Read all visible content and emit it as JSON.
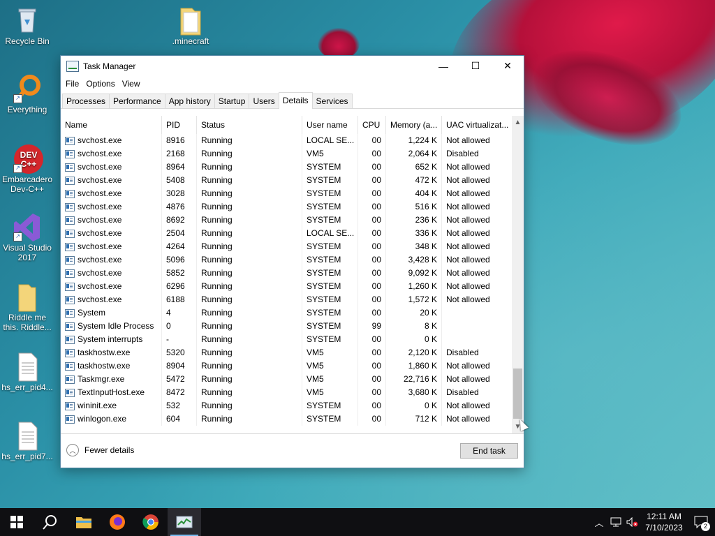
{
  "desktop": {
    "icons": [
      {
        "label": "Recycle Bin"
      },
      {
        "label": ".minecraft"
      },
      {
        "label": "Everything"
      },
      {
        "label": "Embarcadero Dev-C++"
      },
      {
        "label": "Visual Studio 2017"
      },
      {
        "label": "Riddle me this. Riddle..."
      },
      {
        "label": "hs_err_pid4..."
      },
      {
        "label": "hs_err_pid7..."
      }
    ]
  },
  "window": {
    "title": "Task Manager",
    "controls": {
      "minimize": "—",
      "maximize": "☐",
      "close": "✕"
    },
    "menu": [
      "File",
      "Options",
      "View"
    ],
    "tabs": [
      "Processes",
      "Performance",
      "App history",
      "Startup",
      "Users",
      "Details",
      "Services"
    ],
    "active_tab": "Details",
    "columns": [
      "Name",
      "PID",
      "Status",
      "User name",
      "CPU",
      "Memory (a...",
      "UAC virtualizat..."
    ],
    "rows": [
      {
        "name": "svchost.exe",
        "pid": "8916",
        "status": "Running",
        "user": "LOCAL SE...",
        "cpu": "00",
        "mem": "1,224 K",
        "uac": "Not allowed"
      },
      {
        "name": "svchost.exe",
        "pid": "2168",
        "status": "Running",
        "user": "VM5",
        "cpu": "00",
        "mem": "2,064 K",
        "uac": "Disabled"
      },
      {
        "name": "svchost.exe",
        "pid": "8964",
        "status": "Running",
        "user": "SYSTEM",
        "cpu": "00",
        "mem": "652 K",
        "uac": "Not allowed"
      },
      {
        "name": "svchost.exe",
        "pid": "5408",
        "status": "Running",
        "user": "SYSTEM",
        "cpu": "00",
        "mem": "472 K",
        "uac": "Not allowed"
      },
      {
        "name": "svchost.exe",
        "pid": "3028",
        "status": "Running",
        "user": "SYSTEM",
        "cpu": "00",
        "mem": "404 K",
        "uac": "Not allowed"
      },
      {
        "name": "svchost.exe",
        "pid": "4876",
        "status": "Running",
        "user": "SYSTEM",
        "cpu": "00",
        "mem": "516 K",
        "uac": "Not allowed"
      },
      {
        "name": "svchost.exe",
        "pid": "8692",
        "status": "Running",
        "user": "SYSTEM",
        "cpu": "00",
        "mem": "236 K",
        "uac": "Not allowed"
      },
      {
        "name": "svchost.exe",
        "pid": "2504",
        "status": "Running",
        "user": "LOCAL SE...",
        "cpu": "00",
        "mem": "336 K",
        "uac": "Not allowed"
      },
      {
        "name": "svchost.exe",
        "pid": "4264",
        "status": "Running",
        "user": "SYSTEM",
        "cpu": "00",
        "mem": "348 K",
        "uac": "Not allowed"
      },
      {
        "name": "svchost.exe",
        "pid": "5096",
        "status": "Running",
        "user": "SYSTEM",
        "cpu": "00",
        "mem": "3,428 K",
        "uac": "Not allowed"
      },
      {
        "name": "svchost.exe",
        "pid": "5852",
        "status": "Running",
        "user": "SYSTEM",
        "cpu": "00",
        "mem": "9,092 K",
        "uac": "Not allowed"
      },
      {
        "name": "svchost.exe",
        "pid": "6296",
        "status": "Running",
        "user": "SYSTEM",
        "cpu": "00",
        "mem": "1,260 K",
        "uac": "Not allowed"
      },
      {
        "name": "svchost.exe",
        "pid": "6188",
        "status": "Running",
        "user": "SYSTEM",
        "cpu": "00",
        "mem": "1,572 K",
        "uac": "Not allowed"
      },
      {
        "name": "System",
        "pid": "4",
        "status": "Running",
        "user": "SYSTEM",
        "cpu": "00",
        "mem": "20 K",
        "uac": ""
      },
      {
        "name": "System Idle Process",
        "pid": "0",
        "status": "Running",
        "user": "SYSTEM",
        "cpu": "99",
        "mem": "8 K",
        "uac": ""
      },
      {
        "name": "System interrupts",
        "pid": "-",
        "status": "Running",
        "user": "SYSTEM",
        "cpu": "00",
        "mem": "0 K",
        "uac": ""
      },
      {
        "name": "taskhostw.exe",
        "pid": "5320",
        "status": "Running",
        "user": "VM5",
        "cpu": "00",
        "mem": "2,120 K",
        "uac": "Disabled"
      },
      {
        "name": "taskhostw.exe",
        "pid": "8904",
        "status": "Running",
        "user": "VM5",
        "cpu": "00",
        "mem": "1,860 K",
        "uac": "Not allowed"
      },
      {
        "name": "Taskmgr.exe",
        "pid": "5472",
        "status": "Running",
        "user": "VM5",
        "cpu": "00",
        "mem": "22,716 K",
        "uac": "Not allowed"
      },
      {
        "name": "TextInputHost.exe",
        "pid": "8472",
        "status": "Running",
        "user": "VM5",
        "cpu": "00",
        "mem": "3,680 K",
        "uac": "Disabled"
      },
      {
        "name": "wininit.exe",
        "pid": "532",
        "status": "Running",
        "user": "SYSTEM",
        "cpu": "00",
        "mem": "0 K",
        "uac": "Not allowed"
      },
      {
        "name": "winlogon.exe",
        "pid": "604",
        "status": "Running",
        "user": "SYSTEM",
        "cpu": "00",
        "mem": "712 K",
        "uac": "Not allowed"
      }
    ],
    "footer": {
      "fewer_details": "Fewer details",
      "end_task": "End task"
    }
  },
  "taskbar": {
    "clock_time": "12:11 AM",
    "clock_date": "7/10/2023",
    "notification_count": "2"
  },
  "colors": {
    "accent": "#76b9ed",
    "taskbar": "#0f0f12"
  }
}
